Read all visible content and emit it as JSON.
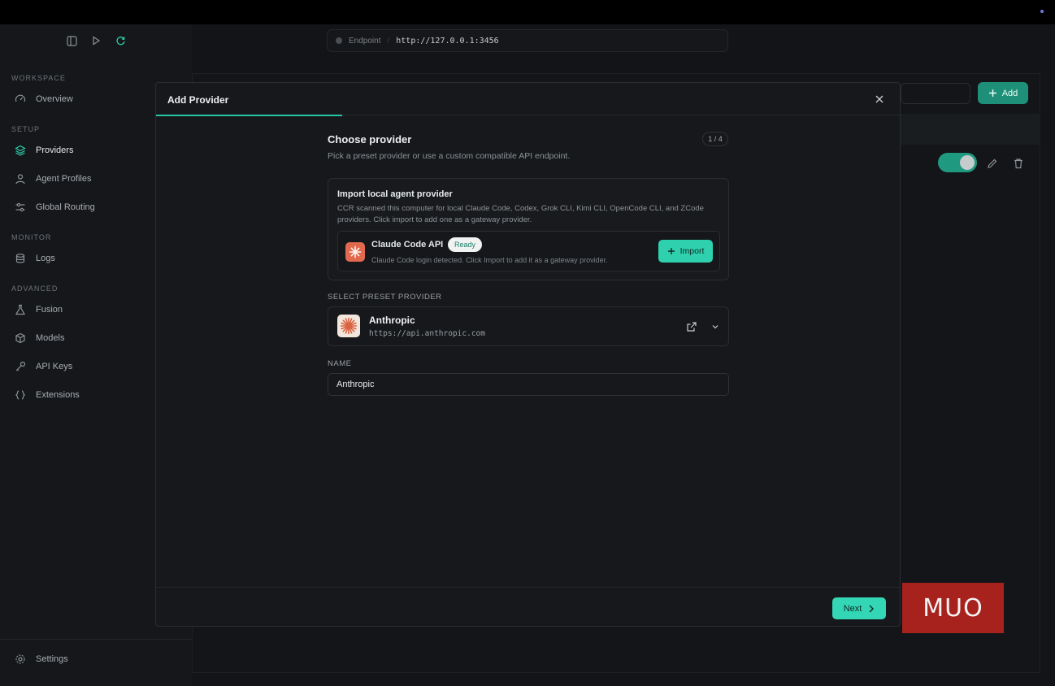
{
  "sidebar": {
    "sections": {
      "workspace": "WORKSPACE",
      "setup": "SETUP",
      "monitor": "MONITOR",
      "advanced": "ADVANCED"
    },
    "items": {
      "overview": "Overview",
      "providers": "Providers",
      "agent_profiles": "Agent Profiles",
      "global_routing": "Global Routing",
      "logs": "Logs",
      "fusion": "Fusion",
      "models": "Models",
      "api_keys": "API Keys",
      "extensions": "Extensions",
      "settings": "Settings"
    },
    "active": "providers"
  },
  "header": {
    "endpoint_label": "Endpoint",
    "endpoint_url": "http://127.0.0.1:3456",
    "add_label": "Add"
  },
  "modal": {
    "title": "Add Provider",
    "step_title": "Choose provider",
    "step_subtitle": "Pick a preset provider or use a custom compatible API endpoint.",
    "step_count": "1 / 4",
    "progress": 0.25,
    "import": {
      "title": "Import local agent provider",
      "description": "CCR scanned this computer for local Claude Code, Codex, Grok CLI, Kimi CLI, OpenCode CLI, and ZCode providers. Click import to add one as a gateway provider.",
      "detected_name": "Claude Code API",
      "detected_status": "Ready",
      "detected_desc": "Claude Code login detected. Click Import to add it as a gateway provider.",
      "button": "Import"
    },
    "preset": {
      "label": "SELECT PRESET PROVIDER",
      "name": "Anthropic",
      "url": "https://api.anthropic.com"
    },
    "name_field": {
      "label": "NAME",
      "value": "Anthropic"
    },
    "next_label": "Next"
  },
  "watermark": "MUO",
  "colors": {
    "accent": "#33d6b5",
    "claude_logo": "#e0694f",
    "watermark_bg": "#a8221d"
  }
}
